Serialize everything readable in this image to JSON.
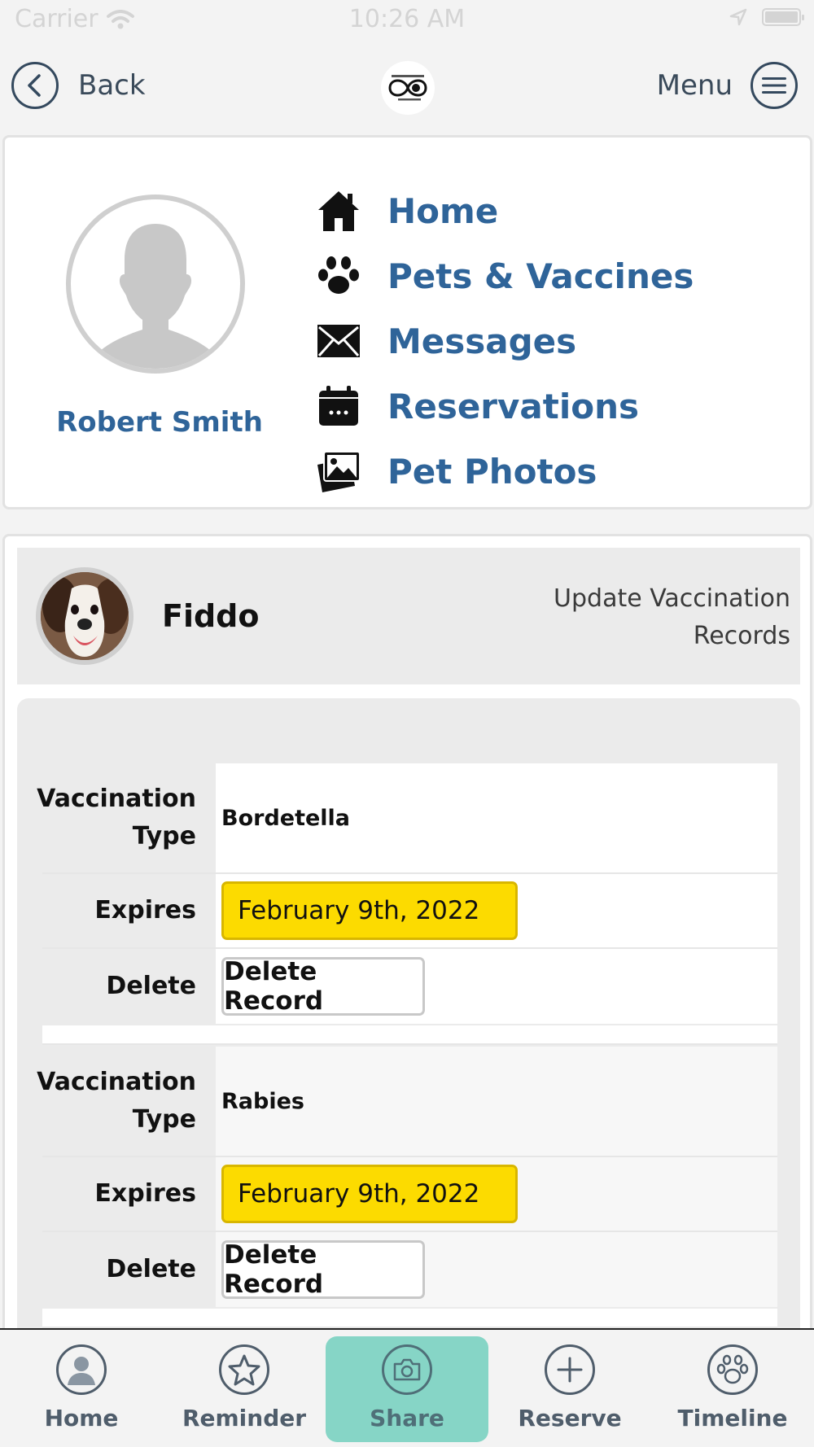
{
  "status_bar": {
    "carrier": "Carrier",
    "time": "10:26 AM"
  },
  "navbar": {
    "back_label": "Back",
    "menu_label": "Menu"
  },
  "profile": {
    "name": "Robert Smith",
    "nav_items": [
      {
        "label": "Home",
        "icon": "house-icon"
      },
      {
        "label": "Pets & Vaccines",
        "icon": "paw-icon"
      },
      {
        "label": "Messages",
        "icon": "envelope-icon"
      },
      {
        "label": "Reservations",
        "icon": "calendar-icon"
      },
      {
        "label": "Pet Photos",
        "icon": "photos-icon"
      }
    ]
  },
  "pet": {
    "name": "Fiddo",
    "update_link": "Update Vaccination Records"
  },
  "records": [
    {
      "type_label": "Vaccination Type",
      "type_value": "Bordetella",
      "expires_label": "Expires",
      "expires_value": "February 9th, 2022",
      "delete_label": "Delete",
      "delete_button": "Delete Record"
    },
    {
      "type_label": "Vaccination Type",
      "type_value": "Rabies",
      "expires_label": "Expires",
      "expires_value": "February 9th, 2022",
      "delete_label": "Delete",
      "delete_button": "Delete Record"
    }
  ],
  "tab_bar": {
    "tabs": [
      {
        "label": "Home",
        "icon": "user-icon"
      },
      {
        "label": "Reminder",
        "icon": "star-icon"
      },
      {
        "label": "Share",
        "icon": "camera-icon",
        "active": true
      },
      {
        "label": "Reserve",
        "icon": "plus-icon"
      },
      {
        "label": "Timeline",
        "icon": "paw-icon"
      }
    ]
  },
  "colors": {
    "link_blue": "#2f6499",
    "date_highlight": "#fcdb00",
    "active_tab": "#86d5c6"
  }
}
